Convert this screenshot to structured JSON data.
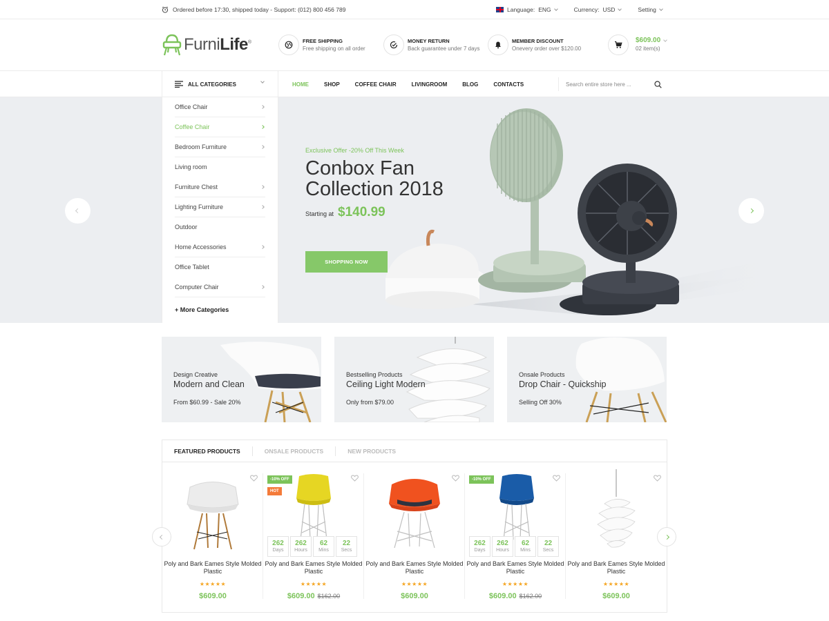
{
  "topbar": {
    "notice": "Ordered before 17:30, shipped today - Support: (012) 800 456 789",
    "language_label": "Language:",
    "language_value": "ENG",
    "currency_label": "Currency:",
    "currency_value": "USD",
    "setting_label": "Setting"
  },
  "header": {
    "logo_light": "Furni",
    "logo_bold": "Life",
    "logo_mark": "®",
    "features": [
      {
        "title": "Free Shipping",
        "subtitle": "Free shipping on all order",
        "icon": "globe-icon"
      },
      {
        "title": "Money Return",
        "subtitle": "Back guarantee under 7 days",
        "icon": "check-circle-icon"
      },
      {
        "title": "Member Discount",
        "subtitle": "Onevery order over $120.00",
        "icon": "bell-icon"
      }
    ],
    "cart": {
      "amount": "$609.00",
      "items": "02 item(s)",
      "icon": "cart-icon"
    }
  },
  "nav": {
    "all_categories": "ALL CATEGORIES",
    "items": [
      {
        "label": "HOME",
        "active": true
      },
      {
        "label": "SHOP"
      },
      {
        "label": "COFFEE CHAIR"
      },
      {
        "label": "LIVINGROOM"
      },
      {
        "label": "BLOG"
      },
      {
        "label": "CONTACTS"
      }
    ],
    "search_placeholder": "Search entire store here ..."
  },
  "categories": [
    {
      "label": "Office Chair",
      "arrow": true
    },
    {
      "label": "Coffee Chair",
      "arrow": true,
      "active": true
    },
    {
      "label": "Bedroom Furniture",
      "arrow": true
    },
    {
      "label": "Living room",
      "arrow": false
    },
    {
      "label": "Furniture Chest",
      "arrow": true
    },
    {
      "label": "Lighting Furniture",
      "arrow": true
    },
    {
      "label": "Outdoor",
      "arrow": false
    },
    {
      "label": "Home Accessories",
      "arrow": true
    },
    {
      "label": "Office Tablet",
      "arrow": false
    },
    {
      "label": "Computer Chair",
      "arrow": true
    }
  ],
  "categories_more": "+  More Categories",
  "hero": {
    "offer": "Exclusive Offer -20% Off This Week",
    "title": "Conbox Fan Collection 2018",
    "starting_label": "Starting at",
    "price": "$140.99",
    "button": "SHOPPING NOW"
  },
  "banners": [
    {
      "subtitle": "Design Creative",
      "title": "Modern and Clean",
      "price_text": "From  $60.99 - Sale 20%"
    },
    {
      "subtitle": "Bestselling Products",
      "title": "Ceiling Light Modern",
      "price_text": "Only  from  $79.00"
    },
    {
      "subtitle": "Onsale Products",
      "title": "Drop Chair - Quickship",
      "price_text": "Selling Off  30%"
    }
  ],
  "product_tabs": [
    "FEATURED PRODUCTS",
    "ONSALE PRODUCTS",
    "NEW PRODUCTS"
  ],
  "countdown_units": [
    "Days",
    "Hours",
    "Mins",
    "Secs"
  ],
  "products": [
    {
      "name": "Poly and Bark Eames Style Molded Plastic",
      "price": "$609.00",
      "old_price": "",
      "stars": "★★★★★",
      "image": "white-armchair",
      "color": "#e9e9e9"
    },
    {
      "name": "Poly and Bark Eames Style Molded Plastic",
      "price": "$609.00",
      "old_price": "$162.00",
      "stars": "★★★★★",
      "badge_off": "-10% OFF",
      "badge_hot": "HOT",
      "countdown": [
        "262",
        "262",
        "62",
        "22"
      ],
      "image": "yellow-chair",
      "color": "#e6d623"
    },
    {
      "name": "Poly and Bark Eames Style Molded Plastic",
      "price": "$609.00",
      "old_price": "",
      "stars": "★★★★★",
      "image": "orange-armchair",
      "color": "#f0521f"
    },
    {
      "name": "Poly and Bark Eames Style Molded Plastic",
      "price": "$609.00",
      "old_price": "$162.00",
      "stars": "★★★★★",
      "badge_off": "-10% OFF",
      "countdown": [
        "262",
        "262",
        "62",
        "22"
      ],
      "image": "blue-chair",
      "color": "#1a5ca8"
    },
    {
      "name": "Poly and Bark Eames Style Molded Plastic",
      "price": "$609.00",
      "old_price": "",
      "stars": "★★★★★",
      "image": "white-pendant-lamp",
      "color": "#f2f2f2"
    }
  ],
  "colors": {
    "accent": "#7cc35a",
    "hot": "#f47b3a",
    "star": "#f5a623"
  }
}
